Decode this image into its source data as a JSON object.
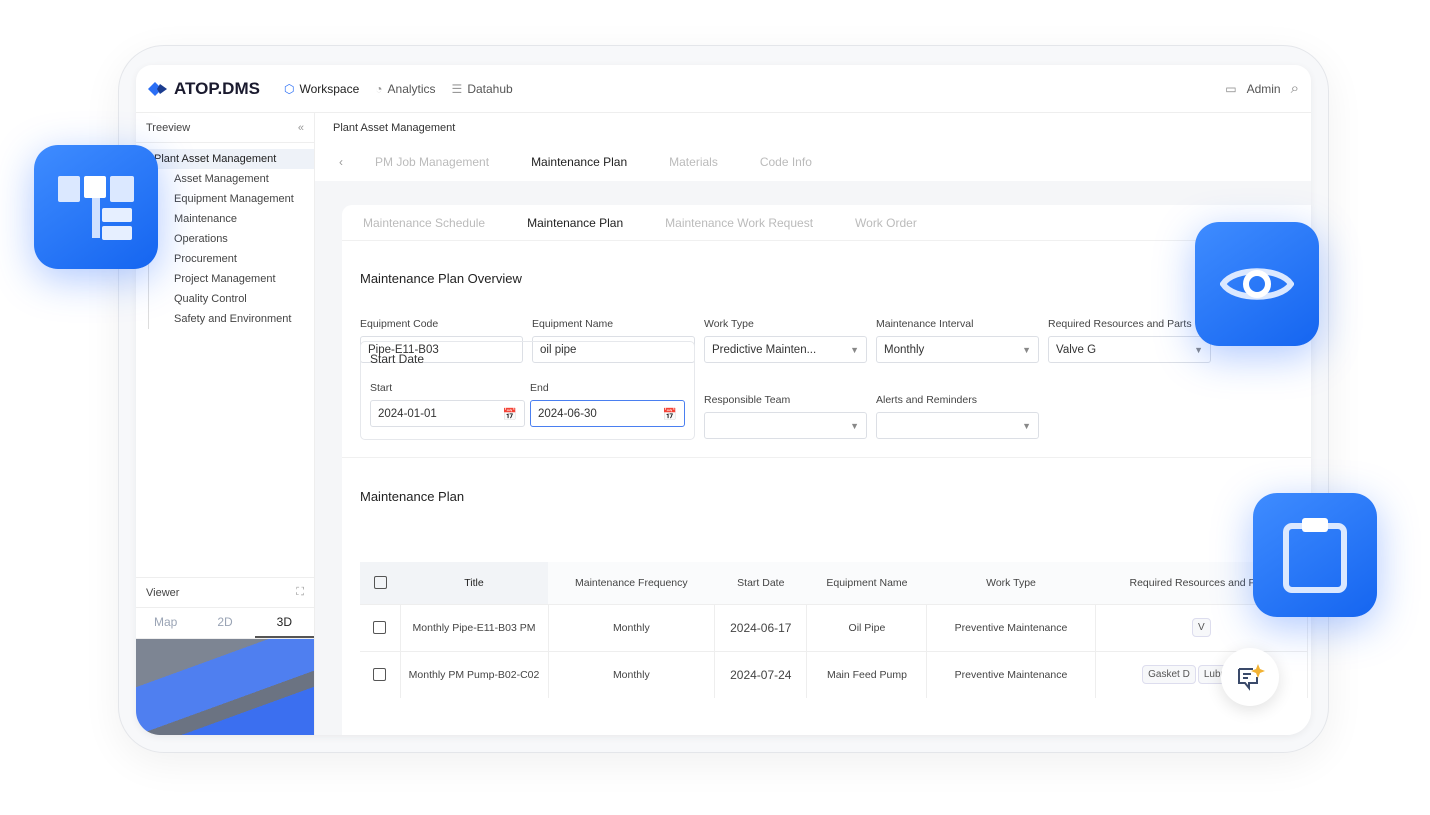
{
  "app": {
    "logo": "ATOP.DMS",
    "nav": [
      "Workspace",
      "Analytics",
      "Datahub"
    ],
    "user": "Admin"
  },
  "sidebar": {
    "title": "Treeview",
    "root": "Plant Asset Management",
    "items": [
      "Asset Management",
      "Equipment Management",
      "Maintenance",
      "Operations",
      "Procurement",
      "Project Management",
      "Quality Control",
      "Safety and Environment"
    ],
    "viewer": {
      "title": "Viewer",
      "tabs": [
        "Map",
        "2D",
        "3D"
      ],
      "active_tab": "3D"
    }
  },
  "breadcrumb": "Plant Asset Management",
  "page_tabs": [
    "PM Job Management",
    "Maintenance Plan",
    "Materials",
    "Code Info"
  ],
  "sub_tabs": [
    "Maintenance Schedule",
    "Maintenance Plan",
    "Maintenance Work Request",
    "Work Order"
  ],
  "overview": {
    "title": "Maintenance Plan Overview",
    "fields": [
      {
        "label": "Equipment Code",
        "value": "Pipe-E11-B03"
      },
      {
        "label": "Equipment Name",
        "value": "oil pipe"
      },
      {
        "label": "Work Type",
        "value": "Predictive Mainten..."
      },
      {
        "label": "Maintenance Interval",
        "value": "Monthly"
      },
      {
        "label": "Required Resources and Parts",
        "value": "Valve G"
      }
    ],
    "start_date": {
      "title": "Start Date",
      "start_label": "Start",
      "start": "2024-01-01",
      "end_label": "End",
      "end": "2024-06-30"
    },
    "responsible_team": {
      "label": "Responsible Team",
      "value": ""
    },
    "alerts": {
      "label": "Alerts and Reminders",
      "value": ""
    }
  },
  "plan": {
    "title": "Maintenance Plan",
    "columns": [
      "Title",
      "Maintenance Frequency",
      "Start Date",
      "Equipment Name",
      "Work Type",
      "Required Resources and Parts"
    ],
    "rows": [
      {
        "title": "Monthly Pipe-E11-B03 PM",
        "freq": "Monthly",
        "start": "2024-06-17",
        "equip": "Oil Pipe",
        "type": "Preventive Maintenance",
        "parts": [
          "V"
        ]
      },
      {
        "title": "Monthly PM Pump-B02-C02",
        "freq": "Monthly",
        "start": "2024-07-24",
        "equip": "Main Feed Pump",
        "type": "Preventive Maintenance",
        "parts": [
          "Gasket D",
          "Lubricant B"
        ]
      }
    ]
  },
  "colors": {
    "accent": "#1f6ff5",
    "active_tab": "#222222",
    "inactive_tab": "#bbbbbb"
  }
}
